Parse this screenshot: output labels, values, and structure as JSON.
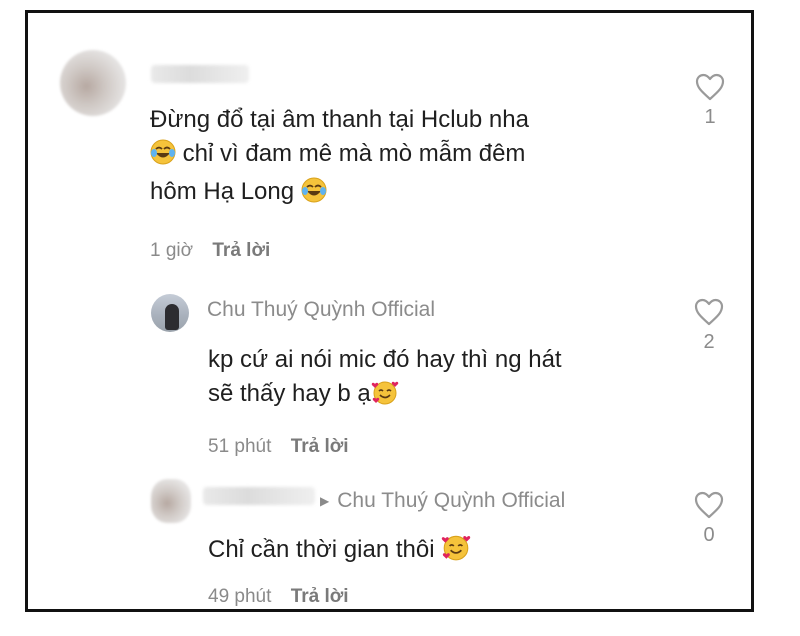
{
  "comments": [
    {
      "author": "",
      "text_lines": [
        "Đừng đổ tại âm thanh tại Hclub nha",
        "chỉ vì đam mê mà mò mẫm đêm",
        "hôm Hạ Long"
      ],
      "time": "1 giờ",
      "reply_label": "Trả lời",
      "likes": "1"
    },
    {
      "author": "Chu Thuý Quỳnh Official",
      "text_lines": [
        "kp cứ ai nói mic đó hay thì ng hát",
        "sẽ thấy hay b ạ"
      ],
      "time": "51 phút",
      "reply_label": "Trả lời",
      "likes": "2"
    },
    {
      "author": "",
      "reply_to": "Chu Thuý Quỳnh Official",
      "text_lines": [
        "Chỉ cần thời gian thôi"
      ],
      "time": "49 phút",
      "reply_label": "Trả lời",
      "likes": "0"
    }
  ],
  "icons": {
    "like": "heart-outline-icon",
    "emoji_laugh": "tears-of-joy-emoji",
    "emoji_love": "smiling-face-with-hearts-emoji"
  },
  "colors": {
    "text": "#1f1f1f",
    "meta": "#8a8a8a",
    "heart_stroke": "#9a9a9a",
    "emoji_yellow": "#f5c33b",
    "heart_red": "#e0245e"
  }
}
